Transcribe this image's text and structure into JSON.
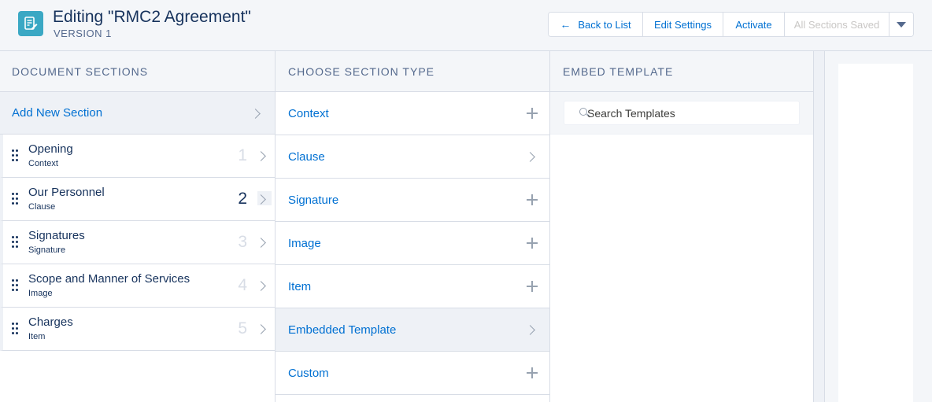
{
  "header": {
    "title": "Editing \"RMC2 Agreement\"",
    "subtitle": "VERSION 1",
    "app_icon": "document-edit-icon",
    "buttons": {
      "back": "Back to List",
      "edit_settings": "Edit Settings",
      "activate": "Activate",
      "saved": "All Sections Saved"
    }
  },
  "document_sections": {
    "header": "DOCUMENT SECTIONS",
    "add_label": "Add New Section",
    "items": [
      {
        "name": "Opening",
        "type": "Context",
        "number": "1"
      },
      {
        "name": "Our Personnel",
        "type": "Clause",
        "number": "2"
      },
      {
        "name": "Signatures",
        "type": "Signature",
        "number": "3"
      },
      {
        "name": "Scope and Manner of Services",
        "type": "Image",
        "number": "4"
      },
      {
        "name": "Charges",
        "type": "Item",
        "number": "5"
      }
    ]
  },
  "section_types": {
    "header": "CHOOSE SECTION TYPE",
    "items": [
      {
        "label": "Context",
        "icon": "plus-icon"
      },
      {
        "label": "Clause",
        "icon": "chevron-right-icon"
      },
      {
        "label": "Signature",
        "icon": "plus-icon"
      },
      {
        "label": "Image",
        "icon": "plus-icon"
      },
      {
        "label": "Item",
        "icon": "plus-icon"
      },
      {
        "label": "Embedded Template",
        "icon": "chevron-right-icon"
      },
      {
        "label": "Custom",
        "icon": "plus-icon"
      }
    ]
  },
  "embed_template": {
    "header": "EMBED TEMPLATE",
    "search_placeholder": "Search Templates"
  },
  "colors": {
    "accent": "#0070d2",
    "text": "#16325c",
    "muted": "#54698d",
    "icon_bg": "#3aa8c4"
  }
}
